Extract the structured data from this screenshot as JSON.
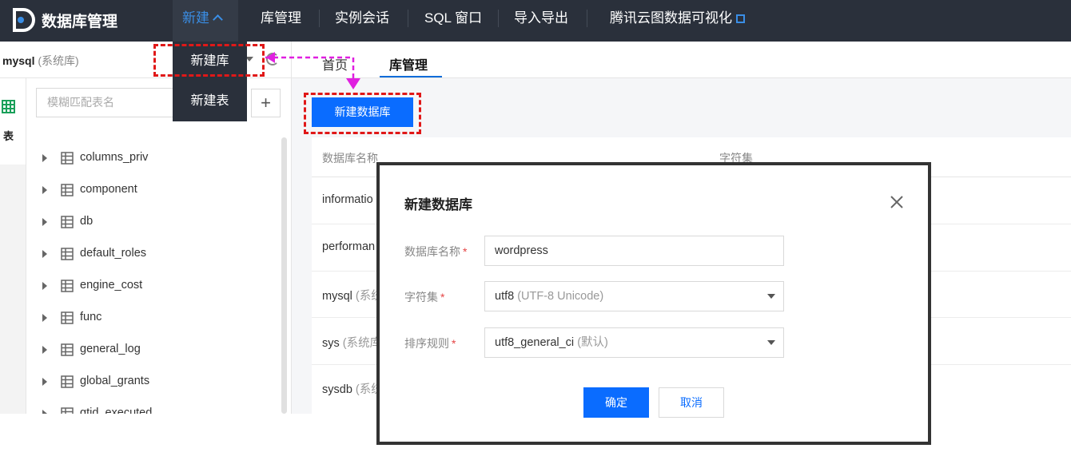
{
  "app": {
    "title": "数据库管理"
  },
  "nav": {
    "items": [
      {
        "label": "新建",
        "active": true
      },
      {
        "label": "库管理"
      },
      {
        "label": "实例会话"
      },
      {
        "label": "SQL 窗口"
      },
      {
        "label": "导入导出"
      },
      {
        "label": "腾讯云图数据可视化"
      }
    ],
    "dropdown": [
      "新建库",
      "新建表"
    ]
  },
  "left": {
    "db_name": "mysql",
    "db_sub": "(系统库)",
    "rail_label": "表",
    "search_placeholder": "模糊匹配表名",
    "add_label": "+",
    "tables": [
      "columns_priv",
      "component",
      "db",
      "default_roles",
      "engine_cost",
      "func",
      "general_log",
      "global_grants",
      "gtid_executed"
    ]
  },
  "tabs": [
    {
      "label": "首页"
    },
    {
      "label": "库管理",
      "active": true
    }
  ],
  "main": {
    "create_button": "新建数据库",
    "columns": [
      "数据库名称",
      "字符集"
    ],
    "rows": [
      {
        "name": "informatio",
        "sub": ""
      },
      {
        "name": "performan",
        "sub": ""
      },
      {
        "name": "mysql",
        "sub": "(系统"
      },
      {
        "name": "sys",
        "sub": "(系统库"
      },
      {
        "name": "sysdb",
        "sub": "(系统"
      }
    ]
  },
  "modal": {
    "title": "新建数据库",
    "fields": {
      "name_label": "数据库名称",
      "name_value": "wordpress",
      "charset_label": "字符集",
      "charset_value": "utf8",
      "charset_sub": "(UTF-8 Unicode)",
      "collation_label": "排序规则",
      "collation_value": "utf8_general_ci",
      "collation_sub": "(默认)",
      "required_mark": "*"
    },
    "ok_label": "确定",
    "cancel_label": "取消"
  },
  "colors": {
    "nav_bg": "#2a303b",
    "primary": "#0a6cff",
    "highlight": "#e01818",
    "arrow": "#e020e0"
  }
}
